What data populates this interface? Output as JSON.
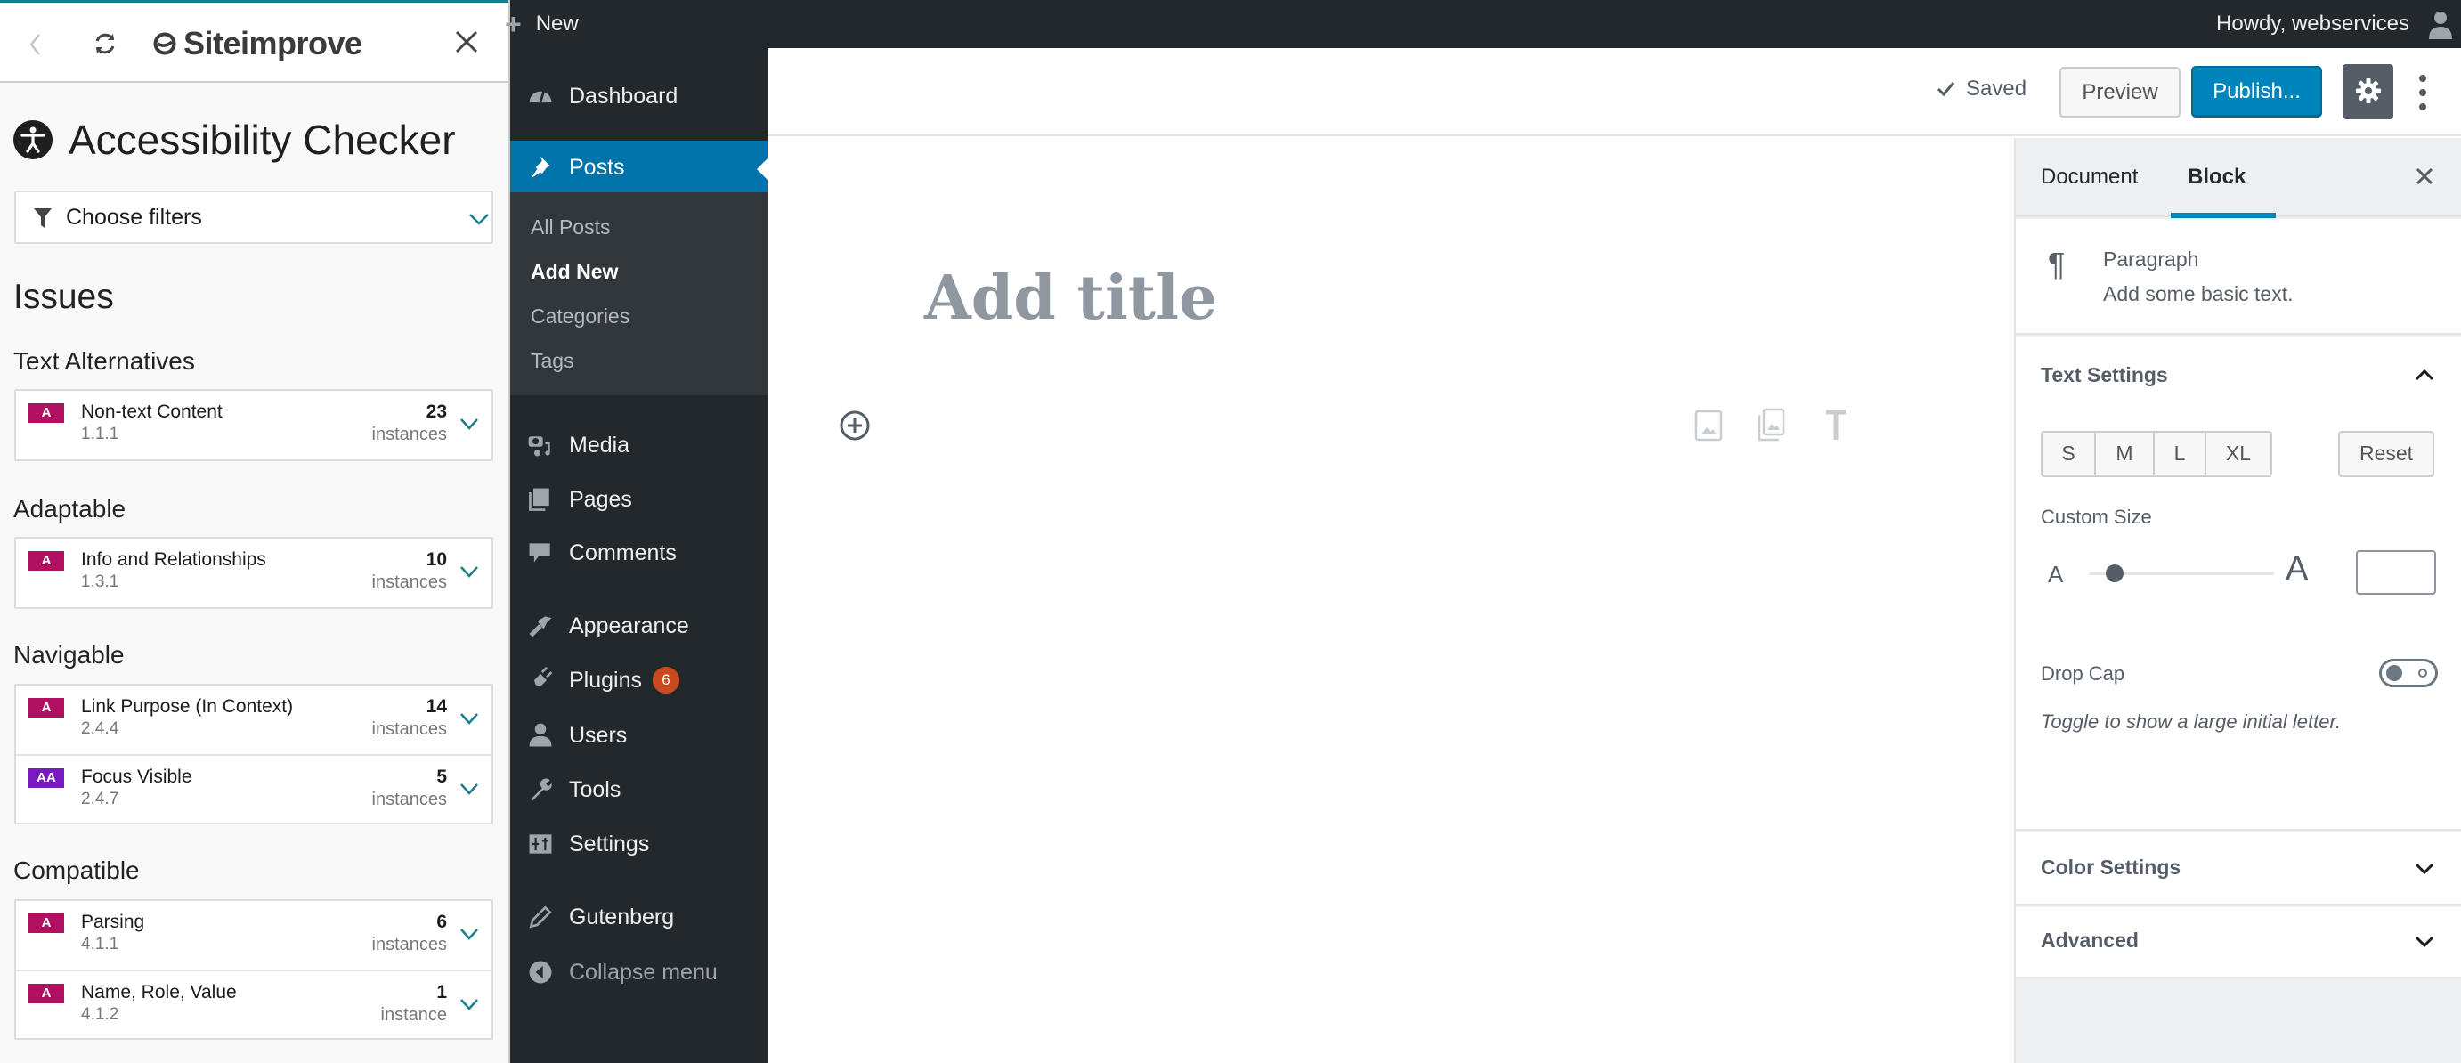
{
  "siteimprove": {
    "brand": "Siteimprove",
    "title": "Accessibility Checker",
    "filter_label": "Choose filters",
    "issues_heading": "Issues",
    "colors": {
      "level_a": "#b0105f",
      "level_aa": "#7a19c0",
      "accent": "#1a7d8c"
    },
    "categories": [
      {
        "name": "Text Alternatives",
        "items": [
          {
            "level": "A",
            "name": "Non-text Content",
            "code": "1.1.1",
            "count": "23",
            "unit": "instances"
          }
        ]
      },
      {
        "name": "Adaptable",
        "items": [
          {
            "level": "A",
            "name": "Info and Relationships",
            "code": "1.3.1",
            "count": "10",
            "unit": "instances"
          }
        ]
      },
      {
        "name": "Navigable",
        "items": [
          {
            "level": "A",
            "name": "Link Purpose (In Context)",
            "code": "2.4.4",
            "count": "14",
            "unit": "instances"
          },
          {
            "level": "AA",
            "name": "Focus Visible",
            "code": "2.4.7",
            "count": "5",
            "unit": "instances"
          }
        ]
      },
      {
        "name": "Compatible",
        "items": [
          {
            "level": "A",
            "name": "Parsing",
            "code": "4.1.1",
            "count": "6",
            "unit": "instances"
          },
          {
            "level": "A",
            "name": "Name, Role, Value",
            "code": "4.1.2",
            "count": "1",
            "unit": "instance"
          }
        ]
      }
    ]
  },
  "adminbar": {
    "new_label": "New",
    "howdy": "Howdy, webservices"
  },
  "menu": {
    "items": [
      {
        "label": "Dashboard",
        "icon": "dashboard-icon"
      },
      {
        "label": "Posts",
        "icon": "pin-icon",
        "active": true
      },
      {
        "label": "Media",
        "icon": "media-icon"
      },
      {
        "label": "Pages",
        "icon": "pages-icon"
      },
      {
        "label": "Comments",
        "icon": "comment-icon"
      },
      {
        "label": "Appearance",
        "icon": "brush-icon"
      },
      {
        "label": "Plugins",
        "icon": "plug-icon",
        "badge": "6"
      },
      {
        "label": "Users",
        "icon": "user-icon"
      },
      {
        "label": "Tools",
        "icon": "wrench-icon"
      },
      {
        "label": "Settings",
        "icon": "sliders-icon"
      },
      {
        "label": "Gutenberg",
        "icon": "pencil-icon"
      },
      {
        "label": "Collapse menu",
        "icon": "collapse-icon"
      }
    ],
    "submenu": [
      {
        "label": "All Posts"
      },
      {
        "label": "Add New",
        "current": true
      },
      {
        "label": "Categories"
      },
      {
        "label": "Tags"
      }
    ]
  },
  "editor": {
    "saved_label": "Saved",
    "preview_label": "Preview",
    "publish_label": "Publish...",
    "title_placeholder": "Add title"
  },
  "sidebar": {
    "tabs": [
      {
        "label": "Document"
      },
      {
        "label": "Block",
        "active": true
      }
    ],
    "block": {
      "name": "Paragraph",
      "description": "Add some basic text."
    },
    "text_settings": {
      "heading": "Text Settings",
      "sizes": [
        "S",
        "M",
        "L",
        "XL"
      ],
      "reset_label": "Reset",
      "custom_size_label": "Custom Size",
      "small_a": "A",
      "large_a": "A",
      "custom_size_value": "",
      "slider_fraction": 0.1,
      "drop_cap_label": "Drop Cap",
      "drop_cap_on": false,
      "drop_cap_hint": "Toggle to show a large initial letter."
    },
    "color_settings": "Color Settings",
    "advanced": "Advanced"
  }
}
